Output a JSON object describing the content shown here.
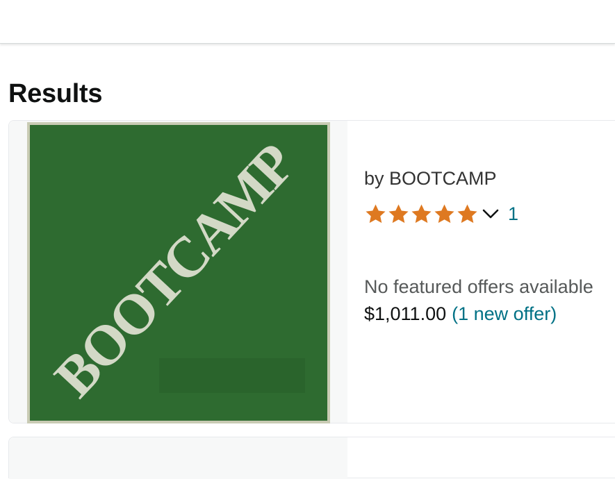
{
  "page": {
    "results_heading": "Results"
  },
  "result": {
    "image_text": "BOOTCAMP",
    "byline": "by BOOTCAMP",
    "rating": {
      "stars": 5,
      "max_stars": 5,
      "count": "1",
      "star_color": "#DE7921",
      "icon": "star-icon"
    },
    "offers_text": "No featured offers available",
    "price": "$1,011.00",
    "offer_link": "(1 new offer)"
  },
  "colors": {
    "image_green": "#2E6B30",
    "image_frame": "#C9CBB4",
    "image_letters": "#D3D9C6",
    "link": "#007185",
    "heading": "#0F1111"
  }
}
